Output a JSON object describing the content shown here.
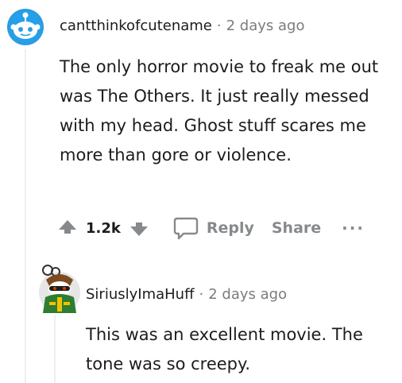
{
  "comment": {
    "username": "cantthinkofcutename",
    "separator": "·",
    "time": "2 days ago",
    "text": "The only horror movie to freak me out was The Others. It just really messed with my head. Ghost stuff scares me more than gore or violence.",
    "icons": {
      "avatar": "snoo-avatar-icon",
      "upvote": "upvote-arrow-icon",
      "downvote": "downvote-arrow-icon",
      "reply": "speech-bubble-icon",
      "more": "more-options-icon"
    },
    "actions": {
      "score": "1.2k",
      "reply_label": "Reply",
      "share_label": "Share",
      "more_label": "···"
    }
  },
  "reply": {
    "username": "SiriuslyImaHuff",
    "separator": "·",
    "time": "2 days ago",
    "text": "This was an excellent movie. The tone was so creepy.",
    "icons": {
      "avatar": "custom-snoo-avatar-icon"
    }
  },
  "colors": {
    "text": "#1c1c1c",
    "muted": "#7c7c7c",
    "action": "#878a8c",
    "thread_line": "#edeff1",
    "avatar_blue": "#0dd3bb"
  }
}
